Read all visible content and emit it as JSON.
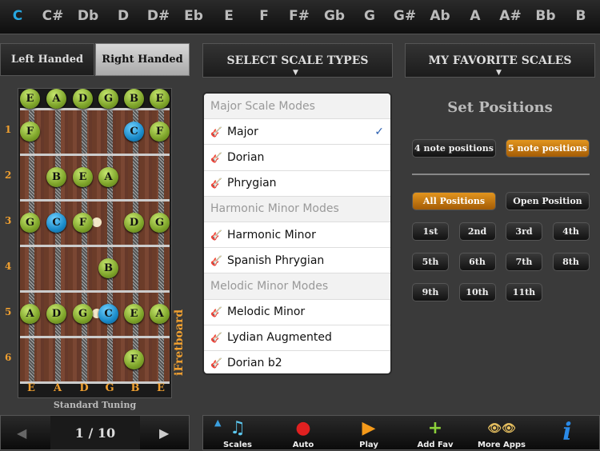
{
  "keys": [
    {
      "label": "C",
      "selected": true
    },
    {
      "label": "C#"
    },
    {
      "label": "Db"
    },
    {
      "label": "D"
    },
    {
      "label": "D#"
    },
    {
      "label": "Eb"
    },
    {
      "label": "E"
    },
    {
      "label": "F"
    },
    {
      "label": "F#"
    },
    {
      "label": "Gb"
    },
    {
      "label": "G"
    },
    {
      "label": "G#"
    },
    {
      "label": "Ab"
    },
    {
      "label": "A"
    },
    {
      "label": "A#"
    },
    {
      "label": "Bb"
    },
    {
      "label": "B"
    }
  ],
  "hand": {
    "left": "Left Handed",
    "right": "Right Handed"
  },
  "header": {
    "scale_types": "SELECT SCALE TYPES",
    "favorites": "MY FAVORITE SCALES"
  },
  "fretboard": {
    "open_notes": [
      "E",
      "A",
      "D",
      "G",
      "B",
      "E"
    ],
    "fret_numbers": [
      "1",
      "2",
      "3",
      "4",
      "5",
      "6"
    ],
    "bottom_labels": [
      "E",
      "A",
      "D",
      "G",
      "B",
      "E"
    ],
    "notes": [
      {
        "fret": 1,
        "string": 0,
        "n": "F"
      },
      {
        "fret": 1,
        "string": 4,
        "n": "C",
        "root": true
      },
      {
        "fret": 1,
        "string": 5,
        "n": "F"
      },
      {
        "fret": 2,
        "string": 1,
        "n": "B"
      },
      {
        "fret": 2,
        "string": 2,
        "n": "E"
      },
      {
        "fret": 2,
        "string": 3,
        "n": "A"
      },
      {
        "fret": 3,
        "string": 0,
        "n": "G"
      },
      {
        "fret": 3,
        "string": 1,
        "n": "C",
        "root": true
      },
      {
        "fret": 3,
        "string": 2,
        "n": "F"
      },
      {
        "fret": 3,
        "string": 4,
        "n": "D"
      },
      {
        "fret": 3,
        "string": 5,
        "n": "G"
      },
      {
        "fret": 4,
        "string": 3,
        "n": "B"
      },
      {
        "fret": 5,
        "string": 0,
        "n": "A"
      },
      {
        "fret": 5,
        "string": 1,
        "n": "D"
      },
      {
        "fret": 5,
        "string": 2,
        "n": "G"
      },
      {
        "fret": 5,
        "string": 3,
        "n": "C",
        "root": true
      },
      {
        "fret": 5,
        "string": 4,
        "n": "E"
      },
      {
        "fret": 5,
        "string": 5,
        "n": "A"
      },
      {
        "fret": 6,
        "string": 4,
        "n": "F"
      }
    ],
    "tuning": "Standard Tuning",
    "brand": "iFretboard"
  },
  "pager": {
    "text": "1 / 10"
  },
  "dropdown": [
    {
      "type": "section",
      "label": "Major Scale Modes"
    },
    {
      "type": "item",
      "label": "Major",
      "checked": true
    },
    {
      "type": "item",
      "label": "Dorian"
    },
    {
      "type": "item",
      "label": "Phrygian"
    },
    {
      "type": "section",
      "label": "Harmonic Minor Modes"
    },
    {
      "type": "item",
      "label": "Harmonic Minor"
    },
    {
      "type": "item",
      "label": "Spanish Phrygian"
    },
    {
      "type": "section",
      "label": "Melodic Minor Modes"
    },
    {
      "type": "item",
      "label": "Melodic Minor"
    },
    {
      "type": "item",
      "label": "Lydian Augmented"
    },
    {
      "type": "item",
      "label": "Dorian b2"
    }
  ],
  "positions": {
    "title": "Set Positions",
    "four": "4 note positions",
    "five": "5 note positions",
    "all": "All Positions",
    "open": "Open Position",
    "list": [
      "1st",
      "2nd",
      "3rd",
      "4th",
      "5th",
      "6th",
      "7th",
      "8th",
      "9th",
      "10th",
      "11th"
    ]
  },
  "toolbar": [
    {
      "label": "Scales",
      "icon": "music-note-icon"
    },
    {
      "label": "Auto",
      "icon": "record-icon"
    },
    {
      "label": "Play",
      "icon": "play-icon"
    },
    {
      "label": "Add Fav",
      "icon": "plus-icon"
    },
    {
      "label": "More Apps",
      "icon": "eyes-icon"
    },
    {
      "label": "",
      "icon": "info-icon"
    }
  ]
}
